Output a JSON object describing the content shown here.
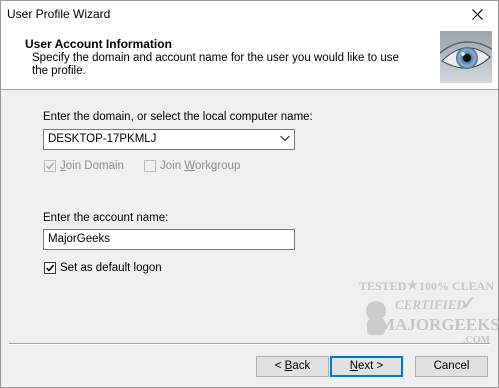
{
  "window": {
    "title": "User Profile Wizard"
  },
  "header": {
    "title": "User Account Information",
    "description": "Specify the domain and account name for the user you would like to use the profile.",
    "image_icon": "eye-icon"
  },
  "domain": {
    "label": "Enter the domain, or select the local computer name:",
    "selected_value": "DESKTOP-17PKMLJ",
    "join_domain": {
      "label_prefix": "",
      "label_accel": "J",
      "label_rest": "oin Domain",
      "checked": true,
      "enabled": false
    },
    "join_workgroup": {
      "label_prefix": "Join ",
      "label_accel": "W",
      "label_rest": "orkgroup",
      "checked": false,
      "enabled": false
    }
  },
  "account": {
    "label": "Enter the account name:",
    "value": "MajorGeeks",
    "default_logon": {
      "label": "Set as default logon",
      "checked": true
    }
  },
  "watermark": {
    "line1": "TESTED",
    "line1b": "100% CLEAN",
    "line2": "CERTIFIED",
    "line3": "MAJORGEEKS",
    "line4": ".COM"
  },
  "buttons": {
    "back": {
      "pre": "< ",
      "accel": "B",
      "rest": "ack"
    },
    "next": {
      "accel": "N",
      "rest": "ext >"
    },
    "cancel": "Cancel"
  },
  "colors": {
    "accent": "#0078d7",
    "background": "#f0f0f0",
    "header_bg": "#ffffff"
  }
}
